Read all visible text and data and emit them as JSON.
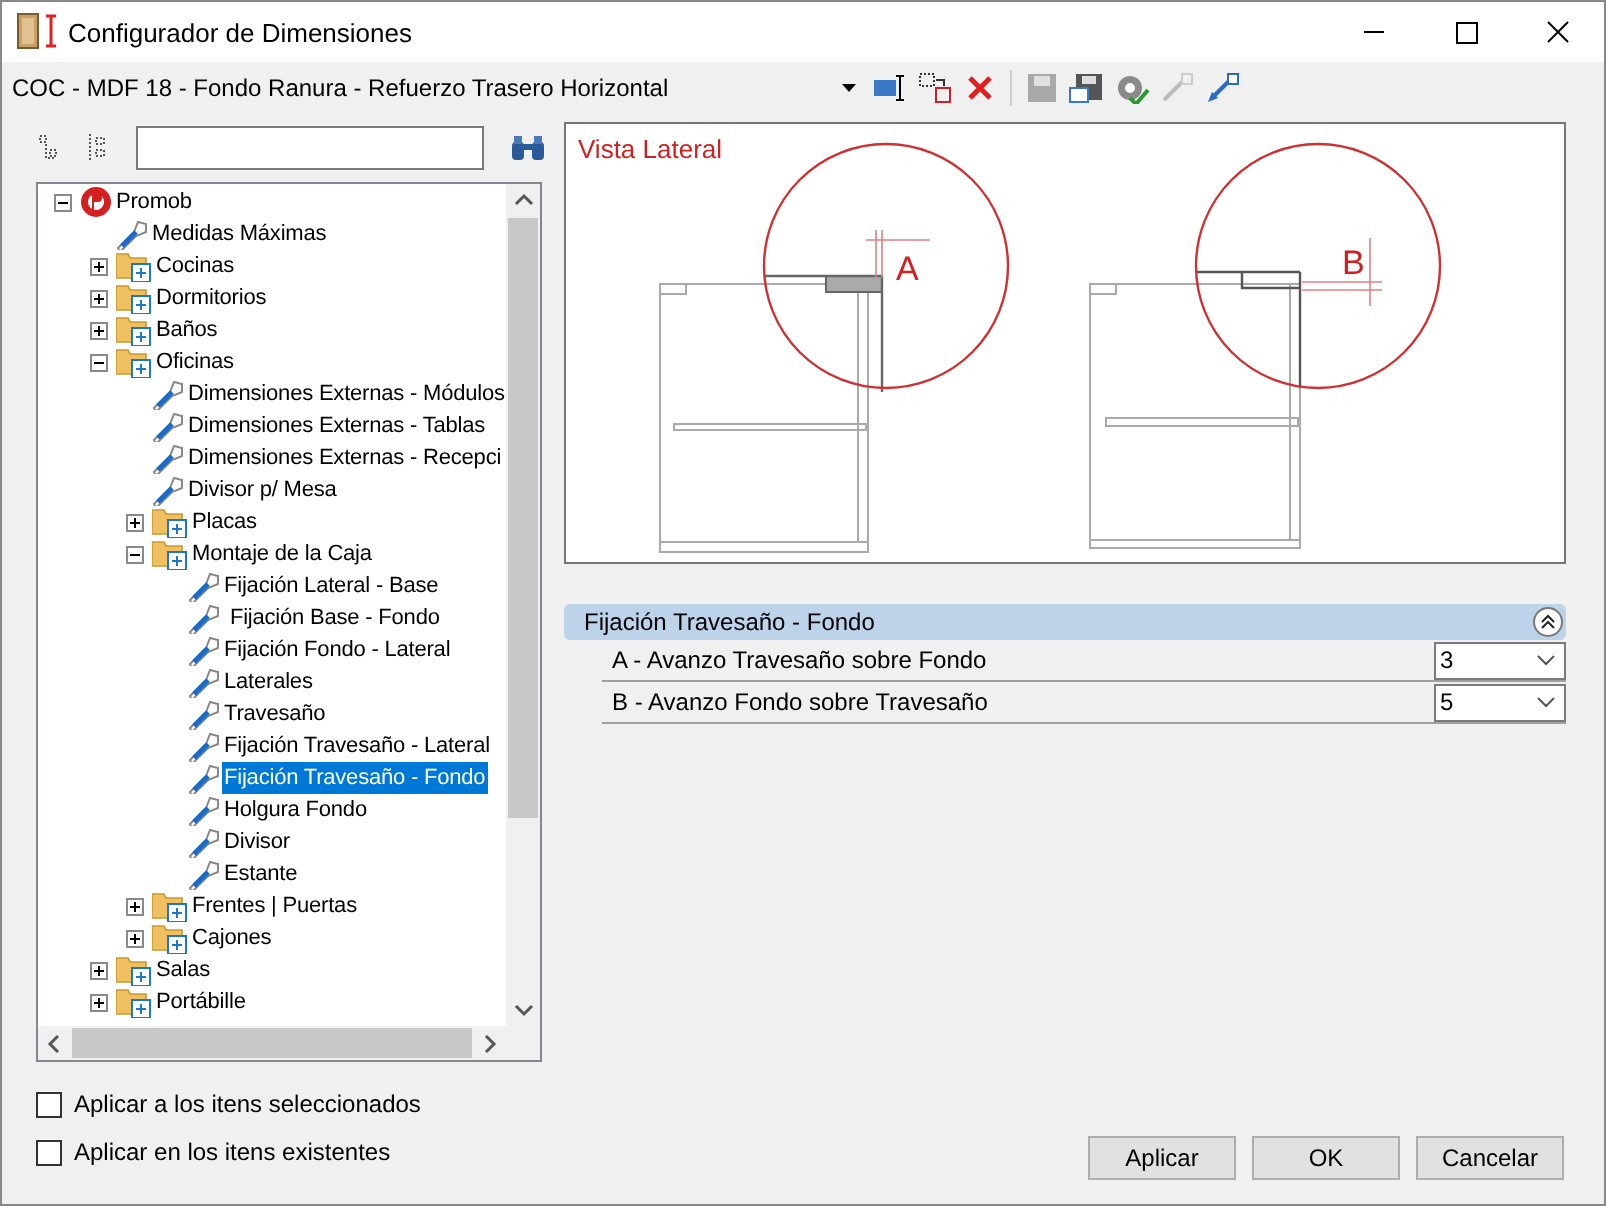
{
  "window": {
    "title": "Configurador de Dimensiones"
  },
  "toolbar": {
    "preset": "COC - MDF 18 - Fondo Ranura - Refuerzo Trasero Horizontal"
  },
  "tree": {
    "items": [
      {
        "label": "Promob",
        "kind": "root",
        "expanded": true,
        "selected": false,
        "children": [
          {
            "label": "Medidas Máximas",
            "kind": "leaf",
            "selected": false
          },
          {
            "label": "Cocinas",
            "kind": "folder",
            "expanded": false,
            "selected": false
          },
          {
            "label": "Dormitorios",
            "kind": "folder",
            "expanded": false,
            "selected": false
          },
          {
            "label": "Baños",
            "kind": "folder",
            "expanded": false,
            "selected": false
          },
          {
            "label": "Oficinas",
            "kind": "folder",
            "expanded": true,
            "selected": false,
            "children": [
              {
                "label": "Dimensiones Externas - Módulos",
                "kind": "leaf",
                "selected": false
              },
              {
                "label": "Dimensiones Externas - Tablas",
                "kind": "leaf",
                "selected": false
              },
              {
                "label": "Dimensiones Externas - Recepci",
                "kind": "leaf",
                "selected": false
              },
              {
                "label": "Divisor p/ Mesa",
                "kind": "leaf",
                "selected": false
              },
              {
                "label": "Placas",
                "kind": "folder",
                "expanded": false,
                "selected": false
              },
              {
                "label": "Montaje de la Caja",
                "kind": "folder",
                "expanded": true,
                "selected": false,
                "children": [
                  {
                    "label": "Fijación Lateral - Base",
                    "kind": "leaf",
                    "selected": false
                  },
                  {
                    "label": " Fijación Base - Fondo",
                    "kind": "leaf",
                    "selected": false
                  },
                  {
                    "label": "Fijación Fondo - Lateral",
                    "kind": "leaf",
                    "selected": false
                  },
                  {
                    "label": "Laterales",
                    "kind": "leaf",
                    "selected": false
                  },
                  {
                    "label": "Travesaño",
                    "kind": "leaf",
                    "selected": false
                  },
                  {
                    "label": "Fijación Travesaño - Lateral",
                    "kind": "leaf",
                    "selected": false
                  },
                  {
                    "label": "Fijación Travesaño - Fondo",
                    "kind": "leaf",
                    "selected": true
                  },
                  {
                    "label": "Holgura Fondo",
                    "kind": "leaf",
                    "selected": false
                  },
                  {
                    "label": "Divisor",
                    "kind": "leaf",
                    "selected": false
                  },
                  {
                    "label": "Estante",
                    "kind": "leaf",
                    "selected": false
                  }
                ]
              },
              {
                "label": "Frentes | Puertas",
                "kind": "folder",
                "expanded": false,
                "selected": false
              },
              {
                "label": "Cajones",
                "kind": "folder",
                "expanded": false,
                "selected": false
              }
            ]
          },
          {
            "label": "Salas",
            "kind": "folder",
            "expanded": false,
            "selected": false
          },
          {
            "label": "Portábille",
            "kind": "folder",
            "expanded": false,
            "selected": false
          }
        ]
      }
    ]
  },
  "diagram": {
    "title": "Vista Lateral",
    "labels": [
      "A",
      "B"
    ]
  },
  "properties": {
    "section": "Fijación Travesaño - Fondo",
    "expanded": true,
    "rows": [
      {
        "label": "A - Avanzo Travesaño sobre Fondo",
        "value": "3"
      },
      {
        "label": "B - Avanzo Fondo sobre Travesaño",
        "value": "5"
      }
    ]
  },
  "options": [
    {
      "label": "Aplicar a los itens seleccionados",
      "checked": false
    },
    {
      "label": "Aplicar en los itens existentes",
      "checked": false
    }
  ],
  "buttons": [
    "Aplicar",
    "OK",
    "Cancelar"
  ]
}
